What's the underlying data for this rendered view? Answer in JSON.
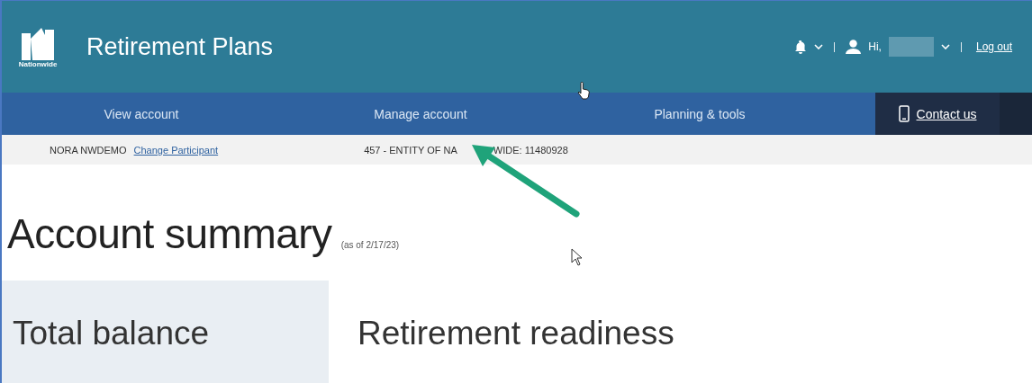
{
  "header": {
    "logo_text": "Nationwide",
    "title": "Retirement Plans",
    "greeting": "Hi,",
    "logout": "Log out"
  },
  "nav": {
    "items": [
      "View account",
      "Manage account",
      "Planning & tools"
    ],
    "contact": "Contact us"
  },
  "participant_bar": {
    "name": "NORA NWDEMO",
    "change_link": "Change Participant",
    "entity_start": "457 - ENTITY OF NA",
    "entity_end": "WIDE: 11480928"
  },
  "page": {
    "title": "Account summary",
    "as_of": "(as of 2/17/23)"
  },
  "cards": [
    {
      "title": "Total balance"
    },
    {
      "title": "Retirement readiness"
    }
  ]
}
